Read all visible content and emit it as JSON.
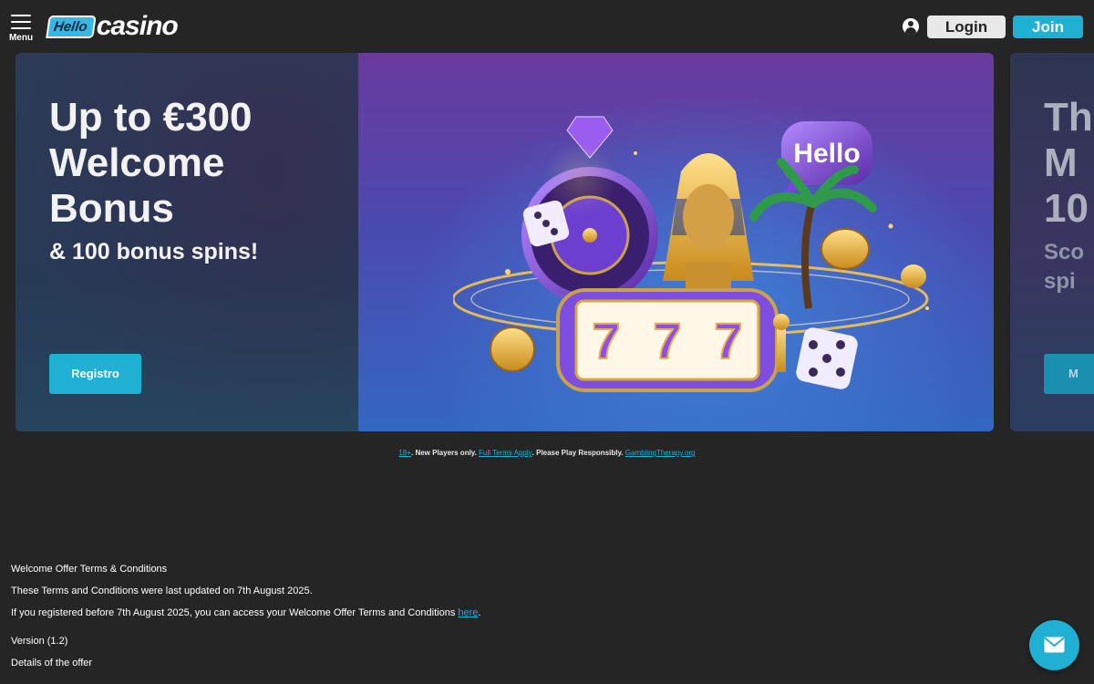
{
  "header": {
    "menu_label": "Menu",
    "logo_hello": "Hello",
    "logo_casino": "casino",
    "login_label": "Login",
    "join_label": "Join"
  },
  "hero": {
    "title": "Up to €300 Welcome Bonus",
    "subtitle": "& 100 bonus spins!",
    "cta_label": "Registro",
    "art_badge": "Hello",
    "reel_symbol": "7"
  },
  "peek_slide": {
    "title_fragment": "Th\nM\n10",
    "subtitle_fragment": "Sco\nspi",
    "cta_fragment": "M"
  },
  "disclaimer": {
    "age": "18+",
    "text1": ". New Players only. ",
    "terms_link": "Full Terms Apply",
    "text2": ". Please Play Responsibly. ",
    "help_link": "GamblingTherapy.org"
  },
  "terms": {
    "heading": "Welcome Offer Terms & Conditions",
    "updated": "These Terms and Conditions were last updated on 7th August 2025.",
    "registered_before": "If you registered before 7th August 2025, you can access your Welcome Offer Terms and Conditions ",
    "here_link": "here",
    "period": ".",
    "version": "Version (1.2)",
    "details_heading": "Details of the offer"
  },
  "colors": {
    "accent": "#1fb0d3",
    "background": "#252525",
    "login_bg": "#e8e8e8"
  },
  "icons": {
    "menu": "hamburger-icon",
    "user": "user-icon",
    "chat": "mail-icon"
  }
}
